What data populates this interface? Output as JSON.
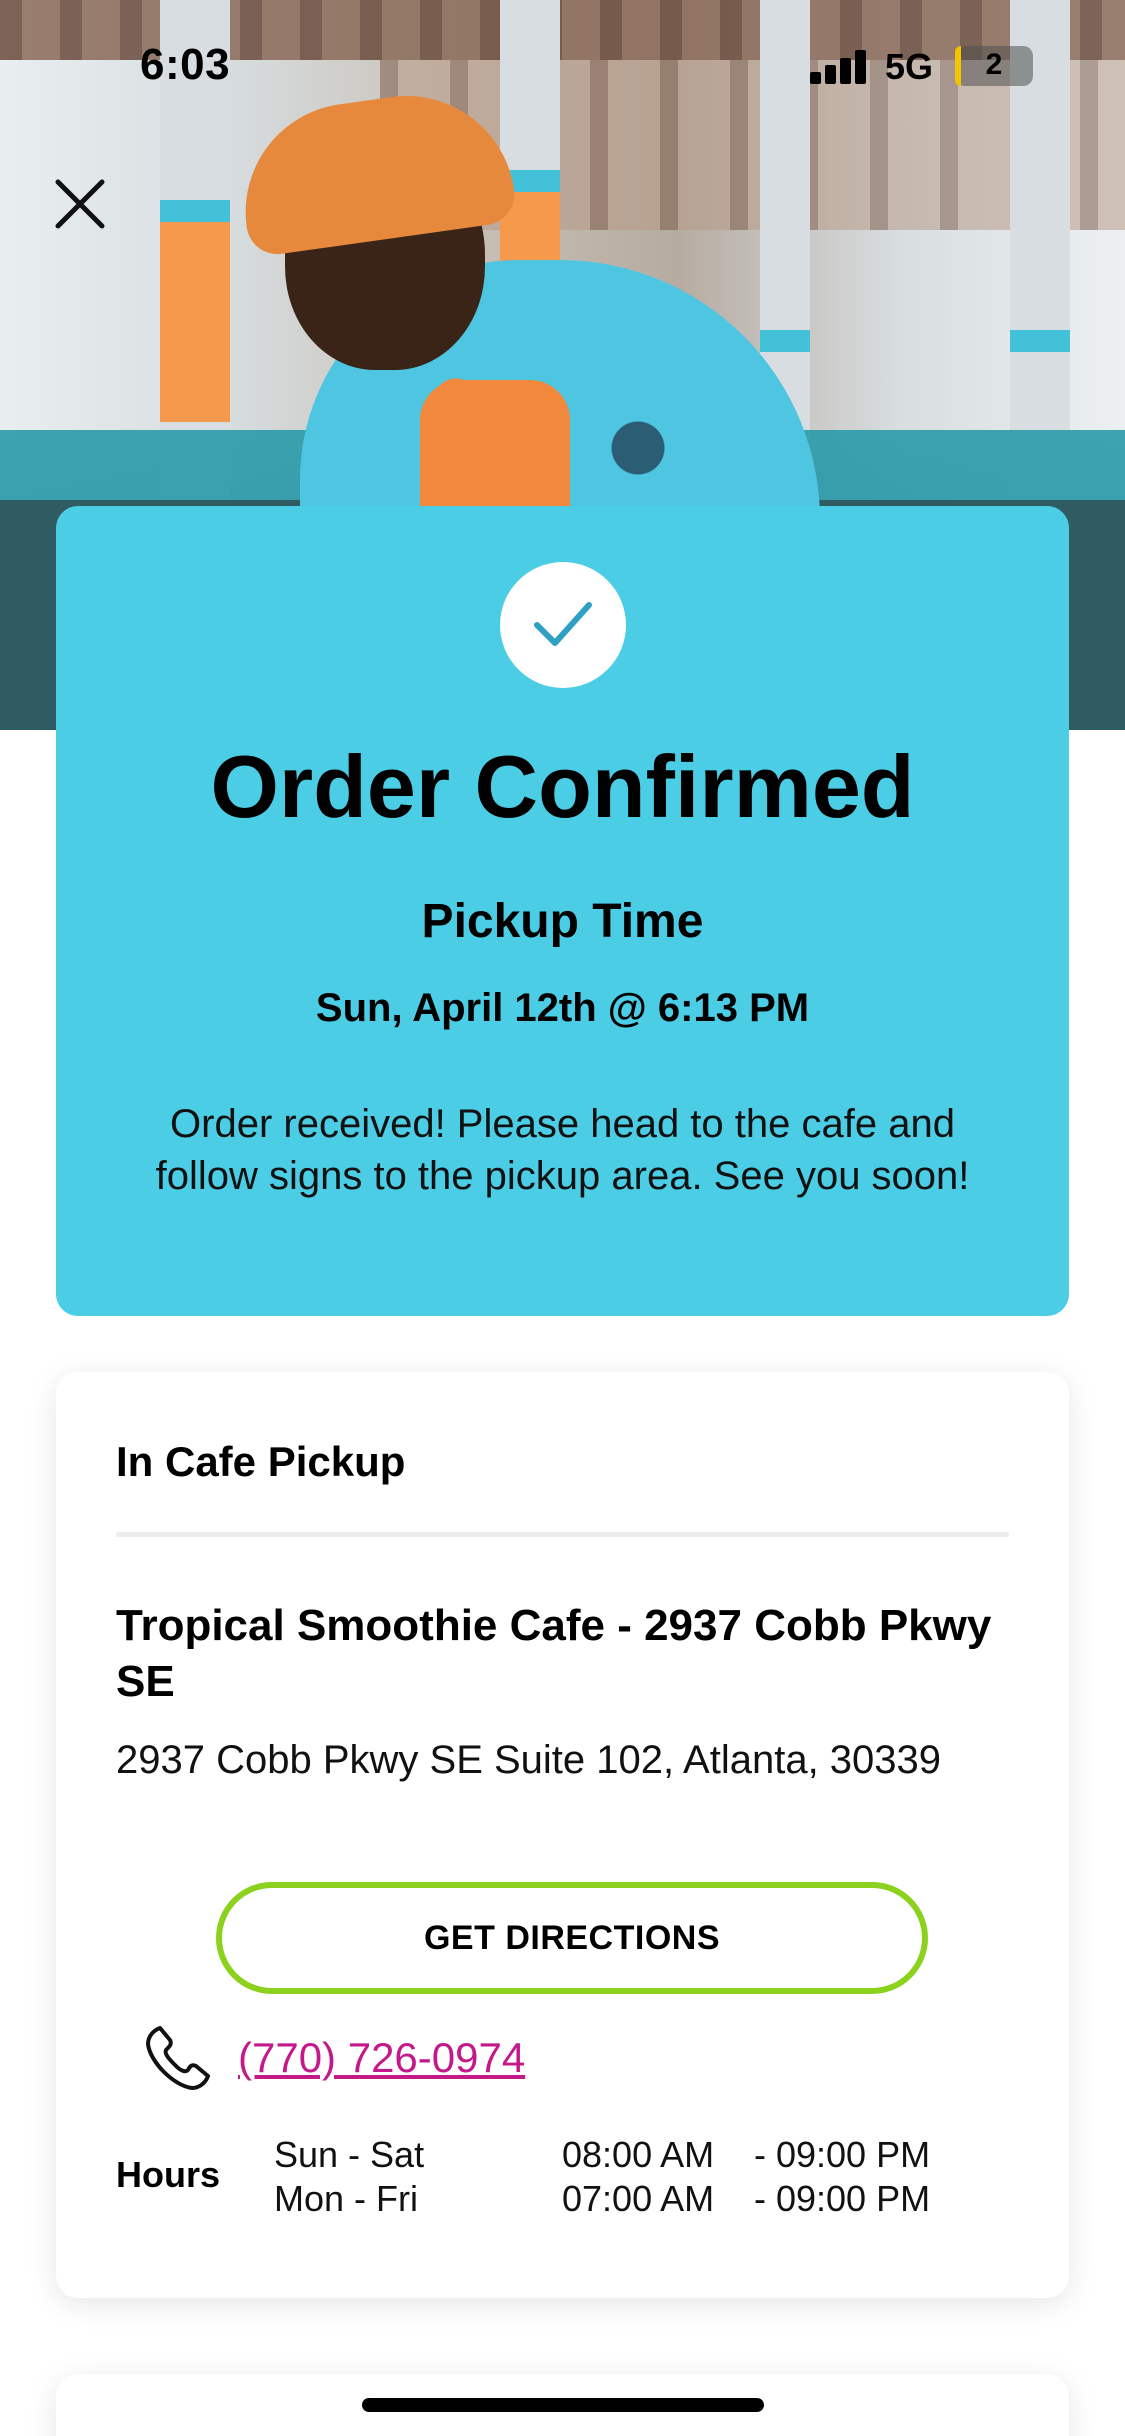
{
  "status_bar": {
    "time": "6:03",
    "network": "5G",
    "battery": "2",
    "battery_color": "#f5c400"
  },
  "header": {
    "close_icon": "close-icon",
    "hero_image": "photo of man in orange bucket hat and tropical shirt"
  },
  "confirmation": {
    "icon": "checkmark-icon",
    "title": "Order Confirmed",
    "pickup_label": "Pickup Time",
    "pickup_time": "Sun, April 12th @ 6:13 PM",
    "message": "Order received! Please head to the cafe and follow signs to the pickup area. See you soon!",
    "background_color": "#4ccde6"
  },
  "pickup": {
    "section_title": "In Cafe Pickup",
    "store_name": "Tropical Smoothie Cafe - 2937 Cobb Pkwy SE",
    "address": "2937 Cobb Pkwy SE Suite 102, Atlanta, 30339",
    "directions_label": "GET DIRECTIONS",
    "directions_border_color": "#8cd11e",
    "phone_icon": "phone-icon",
    "phone": "(770) 726-0974",
    "phone_color": "#c4198a",
    "hours_label": "Hours",
    "hours": [
      {
        "days": "Sun - Sat",
        "open": "08:00 AM",
        "close": "- 09:00 PM"
      },
      {
        "days": "Mon - Fri",
        "open": "07:00 AM",
        "close": "- 09:00 PM"
      }
    ]
  }
}
